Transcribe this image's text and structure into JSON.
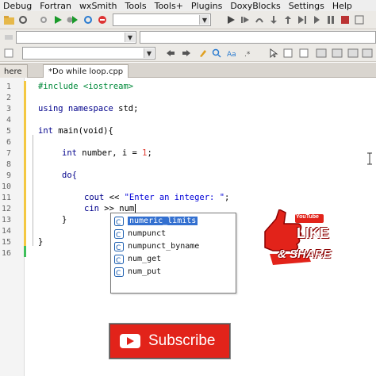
{
  "menu": [
    "Debug",
    "Fortran",
    "wxSmith",
    "Tools",
    "Tools+",
    "Plugins",
    "DoxyBlocks",
    "Settings",
    "Help"
  ],
  "tabs": [
    {
      "label": "here",
      "active": false
    },
    {
      "label": "*Do while loop.cpp",
      "active": true
    }
  ],
  "line_numbers": [
    "1",
    "2",
    "3",
    "4",
    "5",
    "6",
    "7",
    "8",
    "9",
    "10",
    "11",
    "12",
    "13",
    "14",
    "15",
    "16"
  ],
  "code": {
    "l1_pp": "#include <iostream>",
    "l3_kw": "using namespace",
    "l3_rest": " std;",
    "l5_kw": "int",
    "l5_rest": " main(void){",
    "l7_kw": "int",
    "l7_rest": " number, i = ",
    "l7_num": "1",
    "l7_end": ";",
    "l9": "do{",
    "l11_kw": "cout",
    "l11_op": " << ",
    "l11_str": "\"Enter an integer: \"",
    "l11_end": ";",
    "l12_kw": "cin",
    "l12_op": " >> ",
    "l12_typed": "num",
    "l13": "}",
    "l15": "}"
  },
  "autocomplete": [
    {
      "text": "numeric_limits",
      "selected": true
    },
    {
      "text": "numpunct",
      "selected": false
    },
    {
      "text": "numpunct_byname",
      "selected": false
    },
    {
      "text": "num_get",
      "selected": false
    },
    {
      "text": "num_put",
      "selected": false
    }
  ],
  "overlay": {
    "youtube_label": "YouTube",
    "like_text": "LIKE",
    "share_text": "& SHARE",
    "subscribe_label": "Subscribe"
  },
  "colors": {
    "keyword": "#00008b",
    "preprocessor": "#008a3a",
    "string": "#0000d8",
    "number": "#e03c31",
    "selection": "#3370d0",
    "subscribe_red": "#e2231a"
  }
}
